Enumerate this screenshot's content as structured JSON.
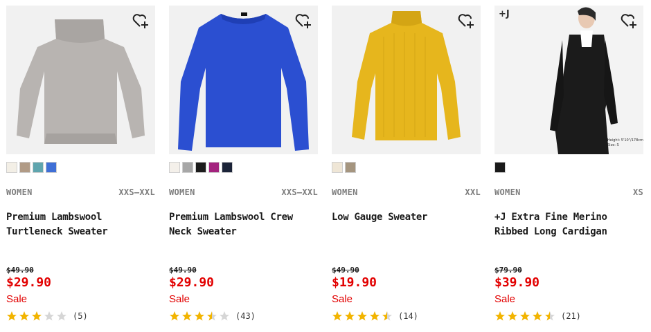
{
  "colors": {
    "sale_red": "#e20000",
    "star_gold": "#f2b400",
    "star_empty": "#d6d6d6"
  },
  "products": [
    {
      "gender": "WOMEN",
      "sizes": "XXS–XXL",
      "name": "Premium Lambswool Turtleneck Sweater",
      "was_price": "$49.90",
      "price": "$29.90",
      "badge": "Sale",
      "rating": 3.0,
      "review_count": "(5)",
      "swatches": [
        "#f3efe6",
        "#b19b86",
        "#5fa5ae",
        "#3f6fd6"
      ],
      "image_icon": "gray-turtleneck-sweater-image",
      "wishlist_icon": "heart-plus-icon"
    },
    {
      "gender": "WOMEN",
      "sizes": "XXS–XXL",
      "name": "Premium Lambswool Crew Neck Sweater",
      "was_price": "$49.90",
      "price": "$29.90",
      "badge": "Sale",
      "rating": 3.5,
      "review_count": "(43)",
      "swatches": [
        "#f4f0ea",
        "#a7a7a7",
        "#1c1c1c",
        "#a3237e",
        "#1b2338"
      ],
      "image_icon": "blue-crew-neck-sweater-image",
      "wishlist_icon": "heart-plus-icon"
    },
    {
      "gender": "WOMEN",
      "sizes": "XXL",
      "name": "Low Gauge Sweater",
      "was_price": "$49.90",
      "price": "$19.90",
      "badge": "Sale",
      "rating": 4.5,
      "review_count": "(14)",
      "swatches": [
        "#efe6d6",
        "#a5957f"
      ],
      "image_icon": "yellow-sweater-image",
      "wishlist_icon": "heart-plus-icon"
    },
    {
      "gender": "WOMEN",
      "sizes": "XS",
      "name": "+J Extra Fine Merino Ribbed Long Cardigan",
      "was_price": "$79.90",
      "price": "$39.90",
      "badge": "Sale",
      "rating": 4.5,
      "review_count": "(21)",
      "swatches": [
        "#1a1a1a"
      ],
      "image_icon": "model-black-cardigan-image",
      "wishlist_icon": "heart-plus-icon",
      "corner_tag": "+J",
      "model_note": [
        "Height: 5'10\"/178cm",
        "Size: S"
      ]
    }
  ]
}
